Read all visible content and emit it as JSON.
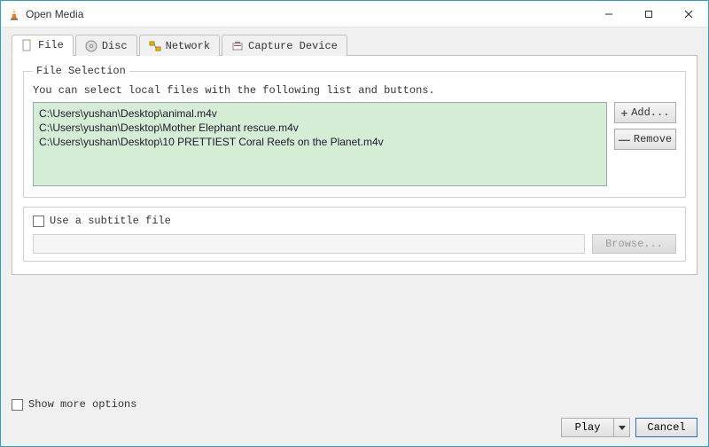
{
  "window": {
    "title": "Open Media"
  },
  "tabs": {
    "file": "File",
    "disc": "Disc",
    "network": "Network",
    "capture": "Capture Device"
  },
  "fileSelection": {
    "legend": "File Selection",
    "hint": "You can select local files with the following list and buttons.",
    "files": [
      "C:\\Users\\yushan\\Desktop\\animal.m4v",
      "C:\\Users\\yushan\\Desktop\\Mother Elephant rescue.m4v",
      "C:\\Users\\yushan\\Desktop\\10 PRETTIEST Coral Reefs on the Planet.m4v"
    ],
    "addLabel": "Add...",
    "removeLabel": "Remove"
  },
  "subtitle": {
    "checkboxLabel": "Use a subtitle file",
    "browseLabel": "Browse..."
  },
  "bottom": {
    "showMore": "Show more options",
    "play": "Play",
    "cancel": "Cancel"
  }
}
